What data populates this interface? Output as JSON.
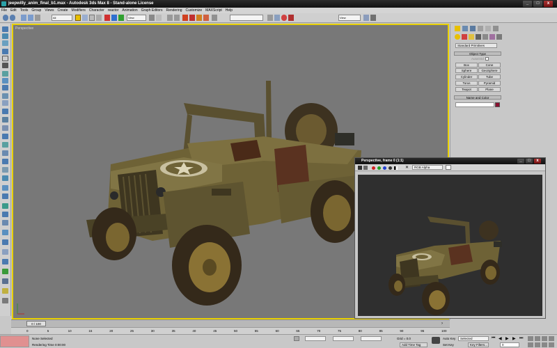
{
  "window": {
    "title": "jeepwilly_anim_final_b1.max - Autodesk 3ds Max 8 - Stand-alone License",
    "controls": [
      "_",
      "□",
      "x"
    ]
  },
  "menu": [
    "File",
    "Edit",
    "Tools",
    "Group",
    "Views",
    "Create",
    "Modifiers",
    "Character",
    "reactor",
    "Animation",
    "Graph Editors",
    "Rendering",
    "Customize",
    "MAXScript",
    "Help"
  ],
  "toolbar": {
    "selection_filter": "All",
    "reference_coord": "View",
    "named_selection": "",
    "render_preset": "View"
  },
  "viewport": {
    "label": "Perspective"
  },
  "command_panel": {
    "category_dropdown": "Standard Primitives",
    "object_type_header": "Object Type",
    "autogrid_label": "AutoGrid",
    "primitives": [
      "Box",
      "Cone",
      "Sphere",
      "GeoSphere",
      "Cylinder",
      "Tube",
      "Torus",
      "Pyramid",
      "Teapot",
      "Plane"
    ],
    "name_color_header": "Name and Color",
    "name_value": "",
    "color": "#8a1030"
  },
  "render_window": {
    "title": "Perspective, frame 0 (1:1)",
    "channel": "RGB Alpha"
  },
  "timeline": {
    "slider": "0 / 100",
    "ticks": [
      "0",
      "5",
      "10",
      "15",
      "20",
      "25",
      "30",
      "35",
      "40",
      "45",
      "50",
      "55",
      "60",
      "65",
      "70",
      "75",
      "80",
      "85",
      "90",
      "95",
      "100"
    ]
  },
  "status": {
    "selection": "None Selected",
    "render_time": "Rendering Time  0:00:00",
    "grid": "Grid = 0.0",
    "add_time_tag": "Add Time Tag",
    "auto_key": "Auto Key",
    "set_key": "Set Key",
    "key_mode": "Selected",
    "key_filters": "Key Filters...",
    "frame": "0"
  },
  "colors": {
    "viewport_bg": "#787878",
    "active_border": "#e8d000",
    "jeep_body": "#6e6236"
  }
}
